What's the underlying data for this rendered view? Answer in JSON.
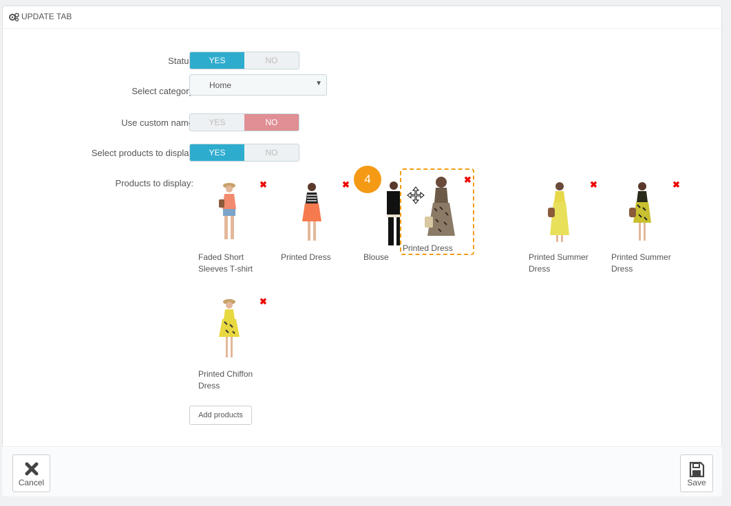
{
  "panel": {
    "title": "UPDATE TAB"
  },
  "form": {
    "status": {
      "label": "Status",
      "yes": "YES",
      "no": "NO",
      "selected": "YES"
    },
    "category": {
      "label": "Select category",
      "value": "Home"
    },
    "custom_name": {
      "label": "Use custom name",
      "yes": "YES",
      "no": "NO",
      "selected": "NO"
    },
    "select_products": {
      "label": "Select products to display",
      "yes": "YES",
      "no": "NO",
      "selected": "YES"
    },
    "products_label": "Products to display:"
  },
  "products": [
    {
      "name": "Faded Short Sleeves T-shirt"
    },
    {
      "name": "Printed Dress"
    },
    {
      "name": "Blouse"
    },
    {
      "name": "Printed Dress"
    },
    {
      "name": "Printed Summer Dress"
    },
    {
      "name": "Printed Summer Dress"
    },
    {
      "name": "Printed Chiffon Dress"
    }
  ],
  "step_badge": "4",
  "add_products_label": "Add products",
  "footer": {
    "cancel_label": "Cancel",
    "save_label": "Save"
  },
  "colors": {
    "accent": "#2eacce",
    "no_active": "#e08f95",
    "badge": "#f49a15",
    "drag_border": "#f39c12"
  }
}
